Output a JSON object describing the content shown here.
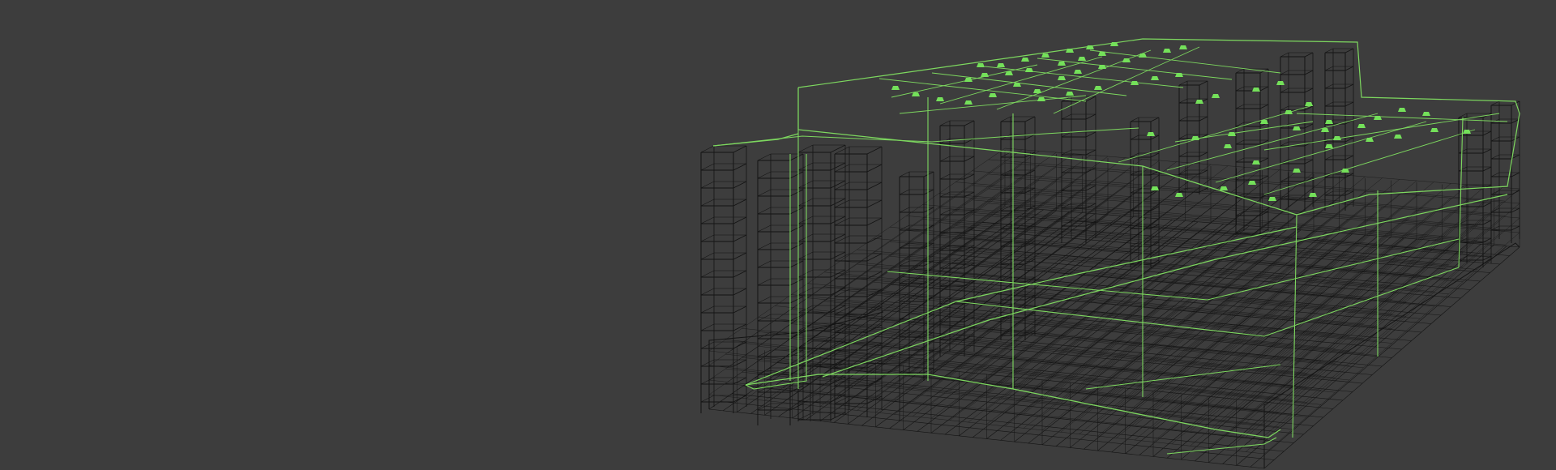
{
  "viewport": {
    "background_color": "#3d3d3d",
    "model": {
      "structure_color": "#141414",
      "piping_color": "#7dd85f",
      "fitting_color": "#74e05a"
    }
  }
}
